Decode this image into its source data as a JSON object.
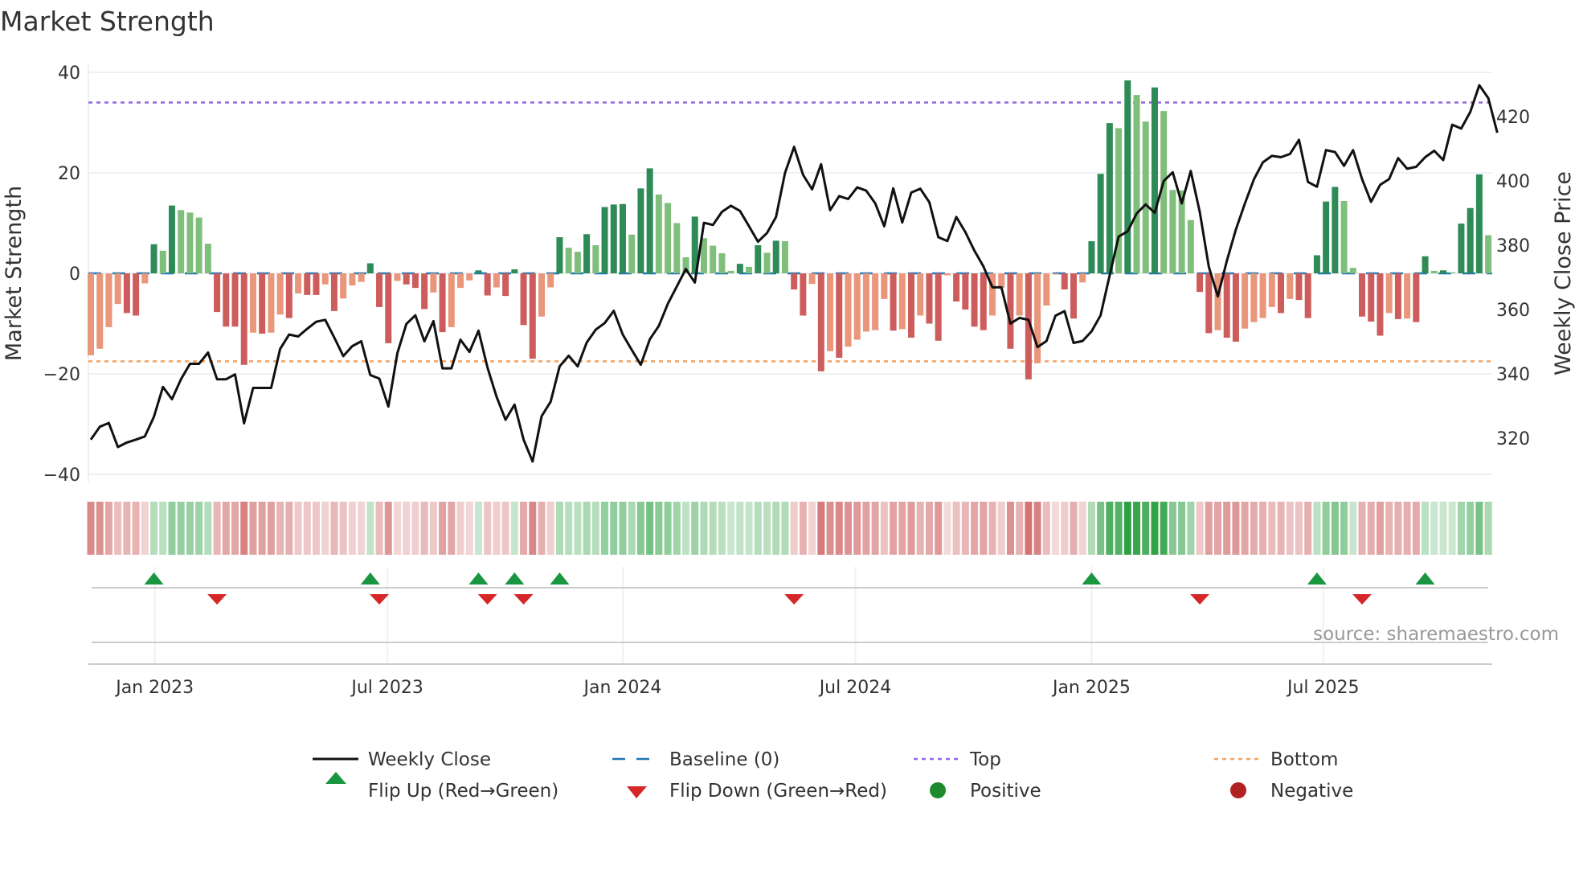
{
  "chart_data": {
    "type": "bar+line",
    "title": "Market Strength",
    "ylabel_left": "Market Strength",
    "ylabel_right": "Weekly Close Price",
    "ylim_left": [
      -40,
      40
    ],
    "ylim_right": [
      308.7,
      433.8
    ],
    "yticks_left": [
      {
        "v": 40,
        "label": "40"
      },
      {
        "v": 20,
        "label": "20"
      },
      {
        "v": 0,
        "label": "0"
      },
      {
        "v": -20,
        "label": "−20"
      },
      {
        "v": -40,
        "label": "−40"
      }
    ],
    "yticks_right": [
      {
        "v": 420,
        "label": "420"
      },
      {
        "v": 400,
        "label": "400"
      },
      {
        "v": 380,
        "label": "380"
      },
      {
        "v": 360,
        "label": "360"
      },
      {
        "v": 340,
        "label": "340"
      },
      {
        "v": 320,
        "label": "320"
      }
    ],
    "xticks": [
      {
        "week": 7.1,
        "label": "Jan 2023"
      },
      {
        "week": 32.9,
        "label": "Jul 2023"
      },
      {
        "week": 59.0,
        "label": "Jan 2024"
      },
      {
        "week": 84.8,
        "label": "Jul 2024"
      },
      {
        "week": 111.0,
        "label": "Jan 2025"
      },
      {
        "week": 136.7,
        "label": "Jul 2025"
      }
    ],
    "top_level": 34,
    "bottom_level": -17.5,
    "baseline": 0,
    "strength": [
      -16.3,
      -15,
      -10.7,
      -6.1,
      -7.9,
      -8.4,
      -2,
      5.8,
      4.5,
      13.5,
      12.6,
      12.1,
      11.1,
      5.9,
      -7.7,
      -10.6,
      -10.6,
      -18.2,
      -11.8,
      -12,
      -11.8,
      -8.2,
      -8.9,
      -4,
      -4.3,
      -4.3,
      -2.2,
      -7.5,
      -5,
      -2.4,
      -1.7,
      2,
      -6.7,
      -13.9,
      -1.5,
      -2.2,
      -2.9,
      -7.1,
      -3.8,
      -11.7,
      -10.7,
      -2.9,
      -1.4,
      0.6,
      -4.4,
      -2.8,
      -4.5,
      0.8,
      -10.3,
      -17,
      -8.6,
      -2.8,
      7.2,
      5.1,
      4.3,
      7.8,
      5.6,
      13.2,
      13.7,
      13.8,
      7.7,
      16.9,
      20.9,
      15.7,
      14,
      10,
      3.2,
      11.3,
      7,
      5.5,
      4,
      0.5,
      1.9,
      1.3,
      5.6,
      4.1,
      6.5,
      6.4,
      -3.2,
      -8.4,
      -2.1,
      -19.5,
      -15.5,
      -16.8,
      -14.6,
      -13.2,
      -11.6,
      -11.3,
      -5.1,
      -11.4,
      -11.1,
      -12.8,
      -8.4,
      -10,
      -13.4,
      -0.4,
      -5.6,
      -7.2,
      -10.6,
      -11.3,
      -8.4,
      -2.9,
      -15,
      -8.4,
      -21.1,
      -17.9,
      -6.4,
      -0.2,
      -3.2,
      -9,
      -1.8,
      6.4,
      19.8,
      29.9,
      28.9,
      38.4,
      35.5,
      30.2,
      37,
      32.3,
      16.6,
      16.5,
      10.6,
      -3.7,
      -11.9,
      -11.3,
      -12.8,
      -13.6,
      -11,
      -9.7,
      -8.9,
      -6.7,
      -7.9,
      -5.1,
      -5.3,
      -8.9,
      3.6,
      14.3,
      17.2,
      14.4,
      1.1,
      -8.6,
      -9.6,
      -12.4,
      -7.9,
      -9.1,
      -9,
      -9.7,
      3.4,
      0.5,
      0.6,
      0.2,
      9.9,
      13,
      19.7,
      7.6
    ],
    "close": [
      319.5,
      323.5,
      324.7,
      317.2,
      318.6,
      319.5,
      320.5,
      326.6,
      335.9,
      332.1,
      338.3,
      343.1,
      343.1,
      346.6,
      338.3,
      338.3,
      339.8,
      324.6,
      335.6,
      335.6,
      335.6,
      347.7,
      352.2,
      351.6,
      354,
      356.2,
      356.8,
      351.3,
      345.5,
      348.6,
      350.1,
      339.6,
      338.5,
      329.8,
      346.4,
      355.5,
      358.2,
      350.1,
      356.4,
      341.7,
      341.7,
      350.6,
      346.8,
      353.4,
      341.9,
      332.9,
      325.7,
      330.4,
      319.5,
      312.7,
      326.8,
      331.3,
      342.3,
      345.6,
      342.3,
      349.7,
      353.7,
      355.8,
      359.6,
      352.2,
      347.4,
      342.8,
      350.7,
      354.9,
      361.8,
      367.2,
      372.6,
      368.4,
      387,
      386.3,
      390.4,
      392.3,
      390.7,
      385.9,
      381.1,
      383.8,
      388.8,
      402.5,
      410.6,
      401.9,
      397.4,
      405.2,
      390.9,
      395.3,
      394.4,
      398,
      397,
      393.1,
      385.9,
      397.7,
      387.1,
      396.4,
      397.6,
      393.4,
      382.5,
      381.3,
      388.8,
      384.1,
      378.3,
      373.4,
      366.9,
      366.9,
      355.6,
      357.4,
      356.8,
      348.3,
      350.2,
      358.1,
      359.5,
      349.6,
      350.2,
      353.2,
      358.2,
      370.6,
      382.7,
      384.3,
      389.9,
      392.7,
      390.1,
      400,
      402.7,
      393,
      403.1,
      390.3,
      373.3,
      364.1,
      375.1,
      384.8,
      393,
      400.5,
      405.8,
      407.8,
      407.4,
      408.4,
      412.8,
      399.7,
      398.2,
      409.6,
      409,
      404.7,
      409.6,
      400.6,
      393.5,
      398.8,
      400.6,
      407.1,
      403.8,
      404.4,
      407.4,
      409.4,
      406.5,
      417.5,
      416.3,
      421.5,
      429.8,
      425.8,
      415
    ],
    "colors": {
      "pos_rising": "#2e8b57",
      "pos_falling": "#7fbf7b",
      "neg_falling": "#cd5c5c",
      "neg_rising": "#e9967a",
      "close_line": "#111111",
      "baseline": "#1f77b4",
      "top": "#9467dd",
      "bottom": "#f4a261",
      "flip_up": "#1a9641",
      "flip_down": "#d62728",
      "positive": "#1e8a2e",
      "negative": "#b22222"
    },
    "legend": {
      "placement": "bottom-center",
      "entries": [
        {
          "key": "close",
          "label": "Weekly Close"
        },
        {
          "key": "baseline",
          "label": "Baseline (0)"
        },
        {
          "key": "top",
          "label": "Top"
        },
        {
          "key": "bottom",
          "label": "Bottom"
        },
        {
          "key": "flip_up",
          "label": "Flip Up (Red→Green)"
        },
        {
          "key": "flip_down",
          "label": "Flip Down (Green→Red)"
        },
        {
          "key": "positive",
          "label": "Positive"
        },
        {
          "key": "negative",
          "label": "Negative"
        }
      ]
    },
    "source": "source: sharemaestro.com"
  }
}
